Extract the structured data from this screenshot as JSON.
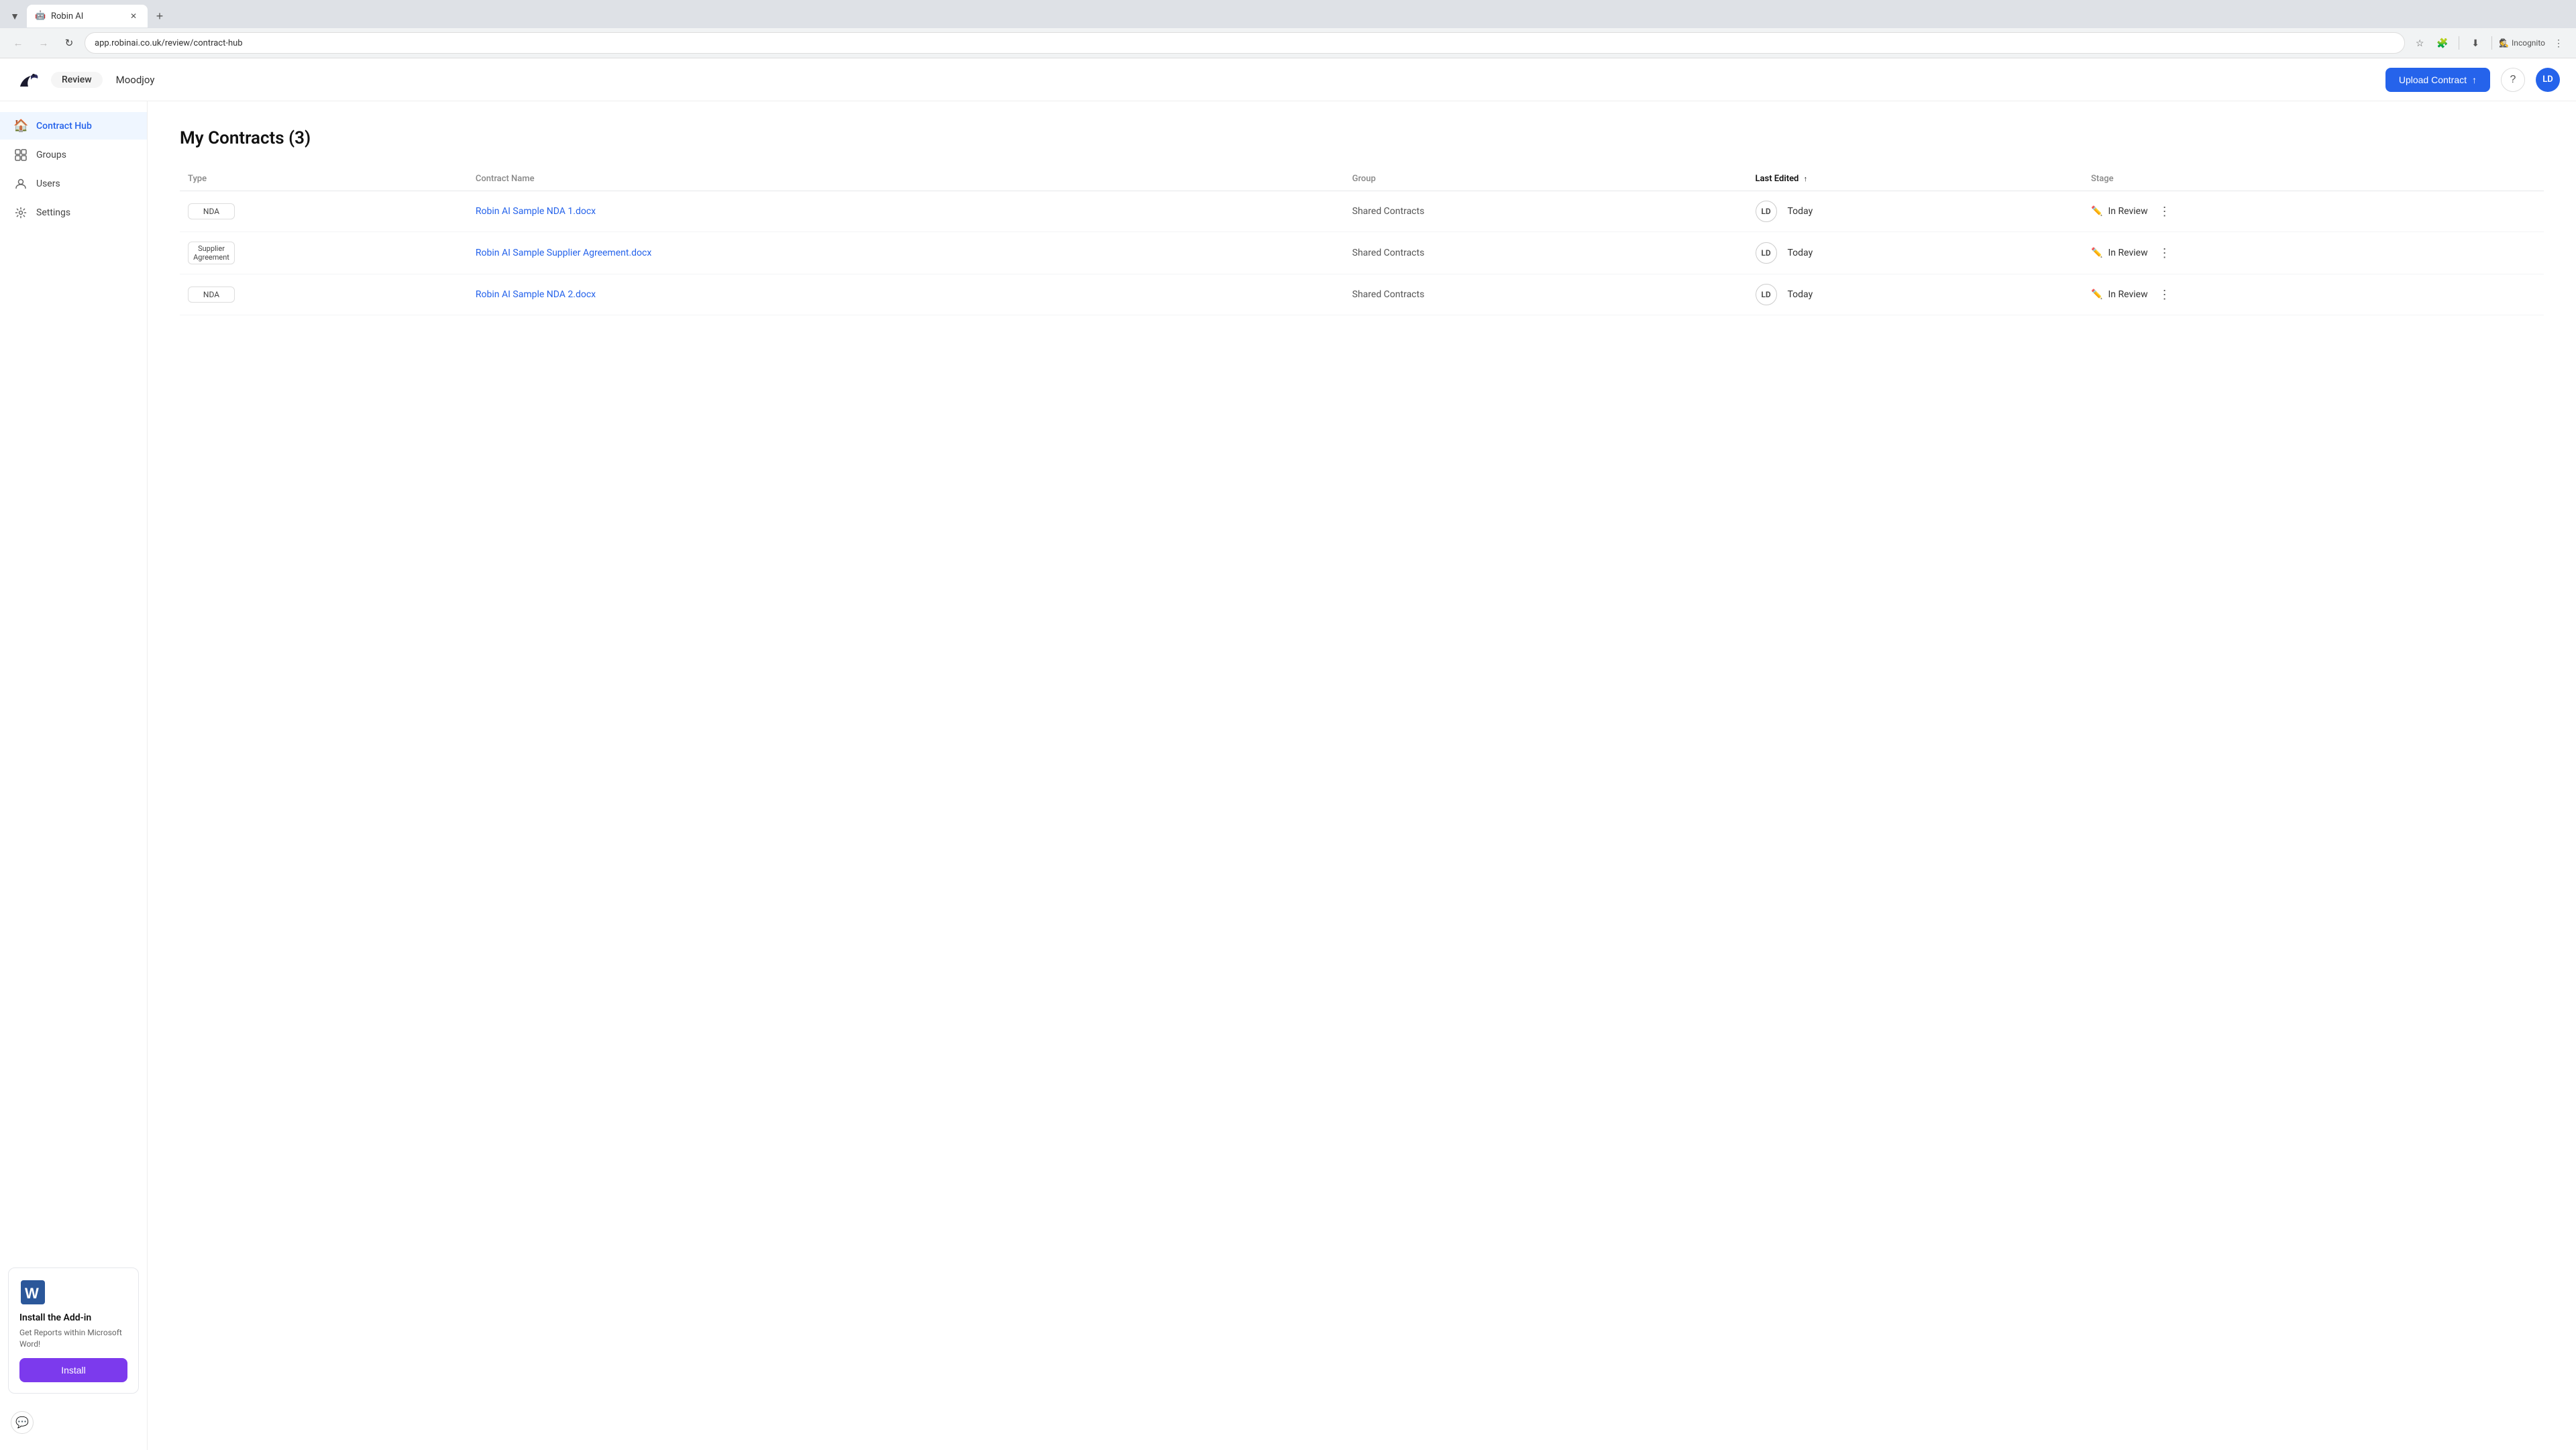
{
  "browser": {
    "tab_favicon": "🤖",
    "tab_title": "Robin AI",
    "url": "app.robinai.co.uk/review/contract-hub",
    "incognito_label": "Incognito",
    "new_tab_tooltip": "New tab"
  },
  "header": {
    "logo_alt": "Robin AI logo",
    "review_label": "Review",
    "company_name": "Moodjoy",
    "upload_button": "Upload Contract",
    "help_tooltip": "Help",
    "user_initials": "LD"
  },
  "sidebar": {
    "items": [
      {
        "id": "contract-hub",
        "label": "Contract Hub",
        "icon": "🏠",
        "active": true
      },
      {
        "id": "groups",
        "label": "Groups",
        "icon": "⊞",
        "active": false
      },
      {
        "id": "users",
        "label": "Users",
        "icon": "👤",
        "active": false
      },
      {
        "id": "settings",
        "label": "Settings",
        "icon": "⚙️",
        "active": false
      }
    ],
    "addins": {
      "title": "Install the Add-in",
      "description": "Get Reports within Microsoft Word!",
      "install_label": "Install"
    }
  },
  "page": {
    "title": "My Contracts (3)",
    "table": {
      "columns": [
        {
          "id": "type",
          "label": "Type",
          "sorted": false
        },
        {
          "id": "name",
          "label": "Contract Name",
          "sorted": false
        },
        {
          "id": "group",
          "label": "Group",
          "sorted": false
        },
        {
          "id": "last_edited",
          "label": "Last Edited",
          "sorted": true,
          "sort_direction": "desc"
        },
        {
          "id": "stage",
          "label": "Stage",
          "sorted": false
        }
      ],
      "rows": [
        {
          "type": "NDA",
          "contract_name": "Robin AI Sample NDA 1.docx",
          "group": "Shared Contracts",
          "last_edited_initials": "LD",
          "last_edited_time": "Today",
          "stage": "In Review"
        },
        {
          "type": "Supplier Agreement",
          "contract_name": "Robin AI Sample Supplier Agreement.docx",
          "group": "Shared Contracts",
          "last_edited_initials": "LD",
          "last_edited_time": "Today",
          "stage": "In Review"
        },
        {
          "type": "NDA",
          "contract_name": "Robin AI Sample NDA 2.docx",
          "group": "Shared Contracts",
          "last_edited_initials": "LD",
          "last_edited_time": "Today",
          "stage": "In Review"
        }
      ]
    }
  },
  "colors": {
    "primary": "#2563eb",
    "purple": "#7c3aed",
    "border": "#e5e7eb",
    "text_muted": "#888"
  }
}
